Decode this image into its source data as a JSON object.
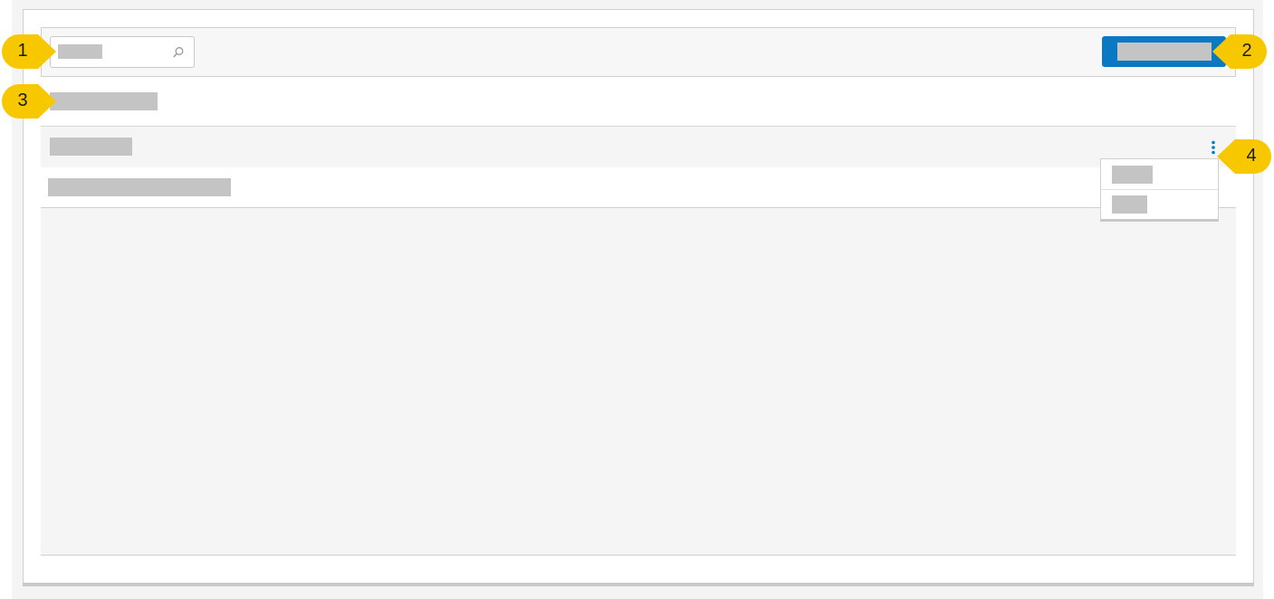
{
  "colors": {
    "primary": "#0a78c2",
    "placeholder": "#c4c4c4",
    "callout": "#f7c800",
    "panel": "#f5f5f5"
  },
  "toolbar": {
    "search_icon": "search-icon",
    "primary_button_icon": null
  },
  "row": {
    "menu_icon": "more-vertical-icon"
  },
  "callouts": [
    "1",
    "2",
    "3",
    "4"
  ]
}
